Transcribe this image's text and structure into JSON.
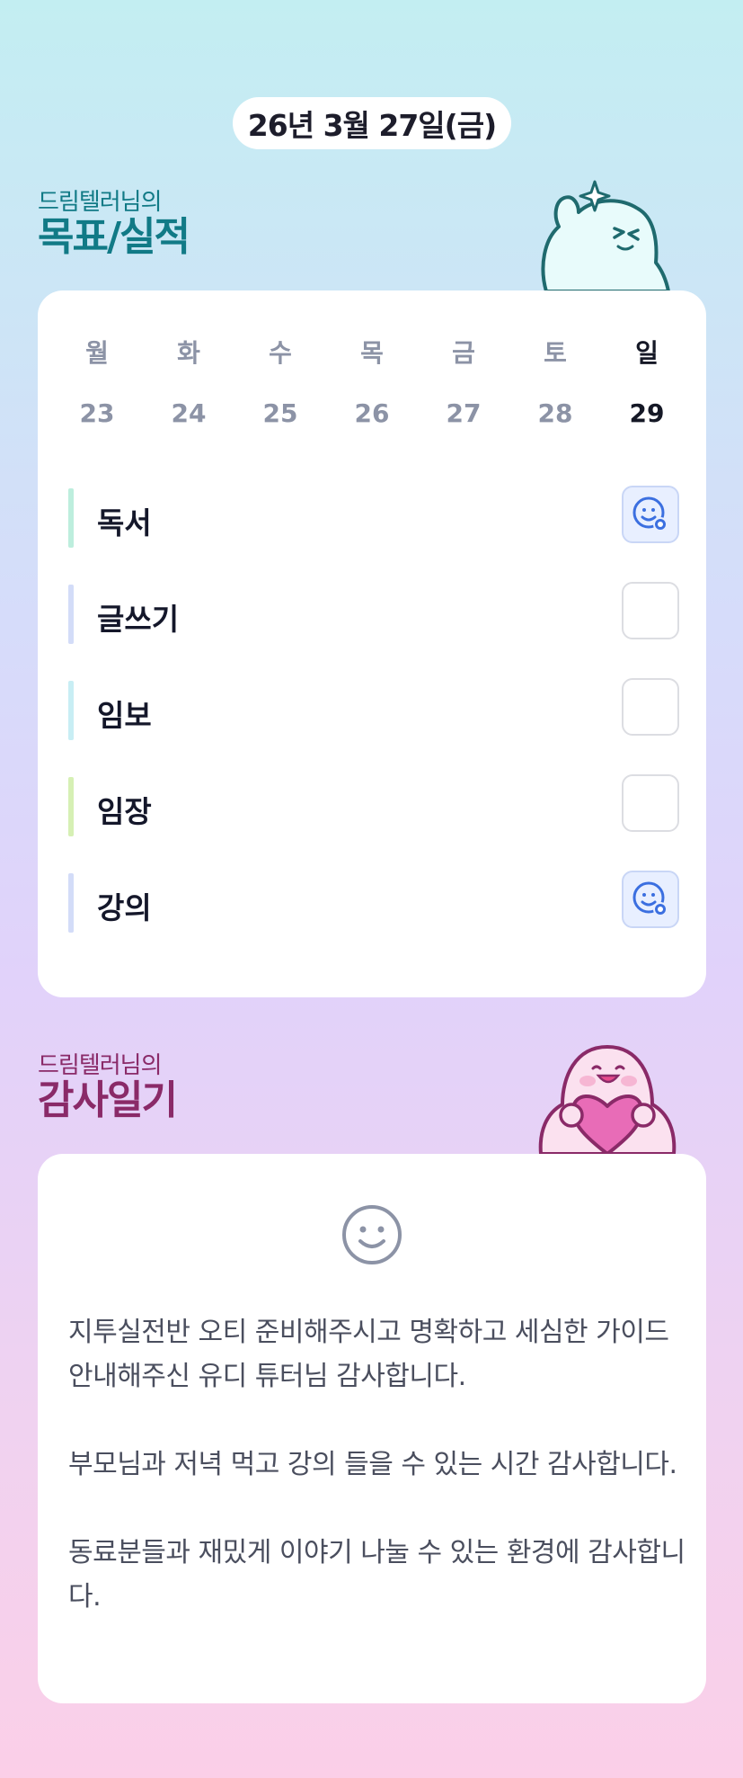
{
  "date": "26년 3월 27일(금)",
  "goal_section": {
    "subtitle": "드림텔러님의",
    "title": "목표/실적"
  },
  "week": [
    {
      "day": "월",
      "date": "23",
      "active": false
    },
    {
      "day": "화",
      "date": "24",
      "active": false
    },
    {
      "day": "수",
      "date": "25",
      "active": false
    },
    {
      "day": "목",
      "date": "26",
      "active": false
    },
    {
      "day": "금",
      "date": "27",
      "active": false
    },
    {
      "day": "토",
      "date": "28",
      "active": false
    },
    {
      "day": "일",
      "date": "29",
      "active": true
    }
  ],
  "goals": [
    {
      "label": "독서",
      "bar_color": "#bdeedd",
      "checked": true
    },
    {
      "label": "글쓰기",
      "bar_color": "#d3dcf8",
      "checked": false
    },
    {
      "label": "임보",
      "bar_color": "#c8eef4",
      "checked": false
    },
    {
      "label": "임장",
      "bar_color": "#d6f0b4",
      "checked": false
    },
    {
      "label": "강의",
      "bar_color": "#d3dcf8",
      "checked": true
    }
  ],
  "gratitude_section": {
    "subtitle": "드림텔러님의",
    "title": "감사일기",
    "entries": [
      "지투실전반 오티 준비해주시고 명확하고 세심한 가이드 안내해주신 유디 튜터님 감사합니다.",
      "부모님과 저녁 먹고 강의 들을 수 있는 시간 감사합니다.",
      "동료분들과 재밌게 이야기 나눌 수 있는 환경에 감사합니다."
    ]
  },
  "colors": {
    "goal_title": "#117a86",
    "gratitude_title": "#8a2a68",
    "check_icon": "#3b6fe0",
    "check_bg": "#e8efff"
  },
  "icons": {
    "check_mark": "smiley-check-icon",
    "mood": "smile-face-icon"
  }
}
